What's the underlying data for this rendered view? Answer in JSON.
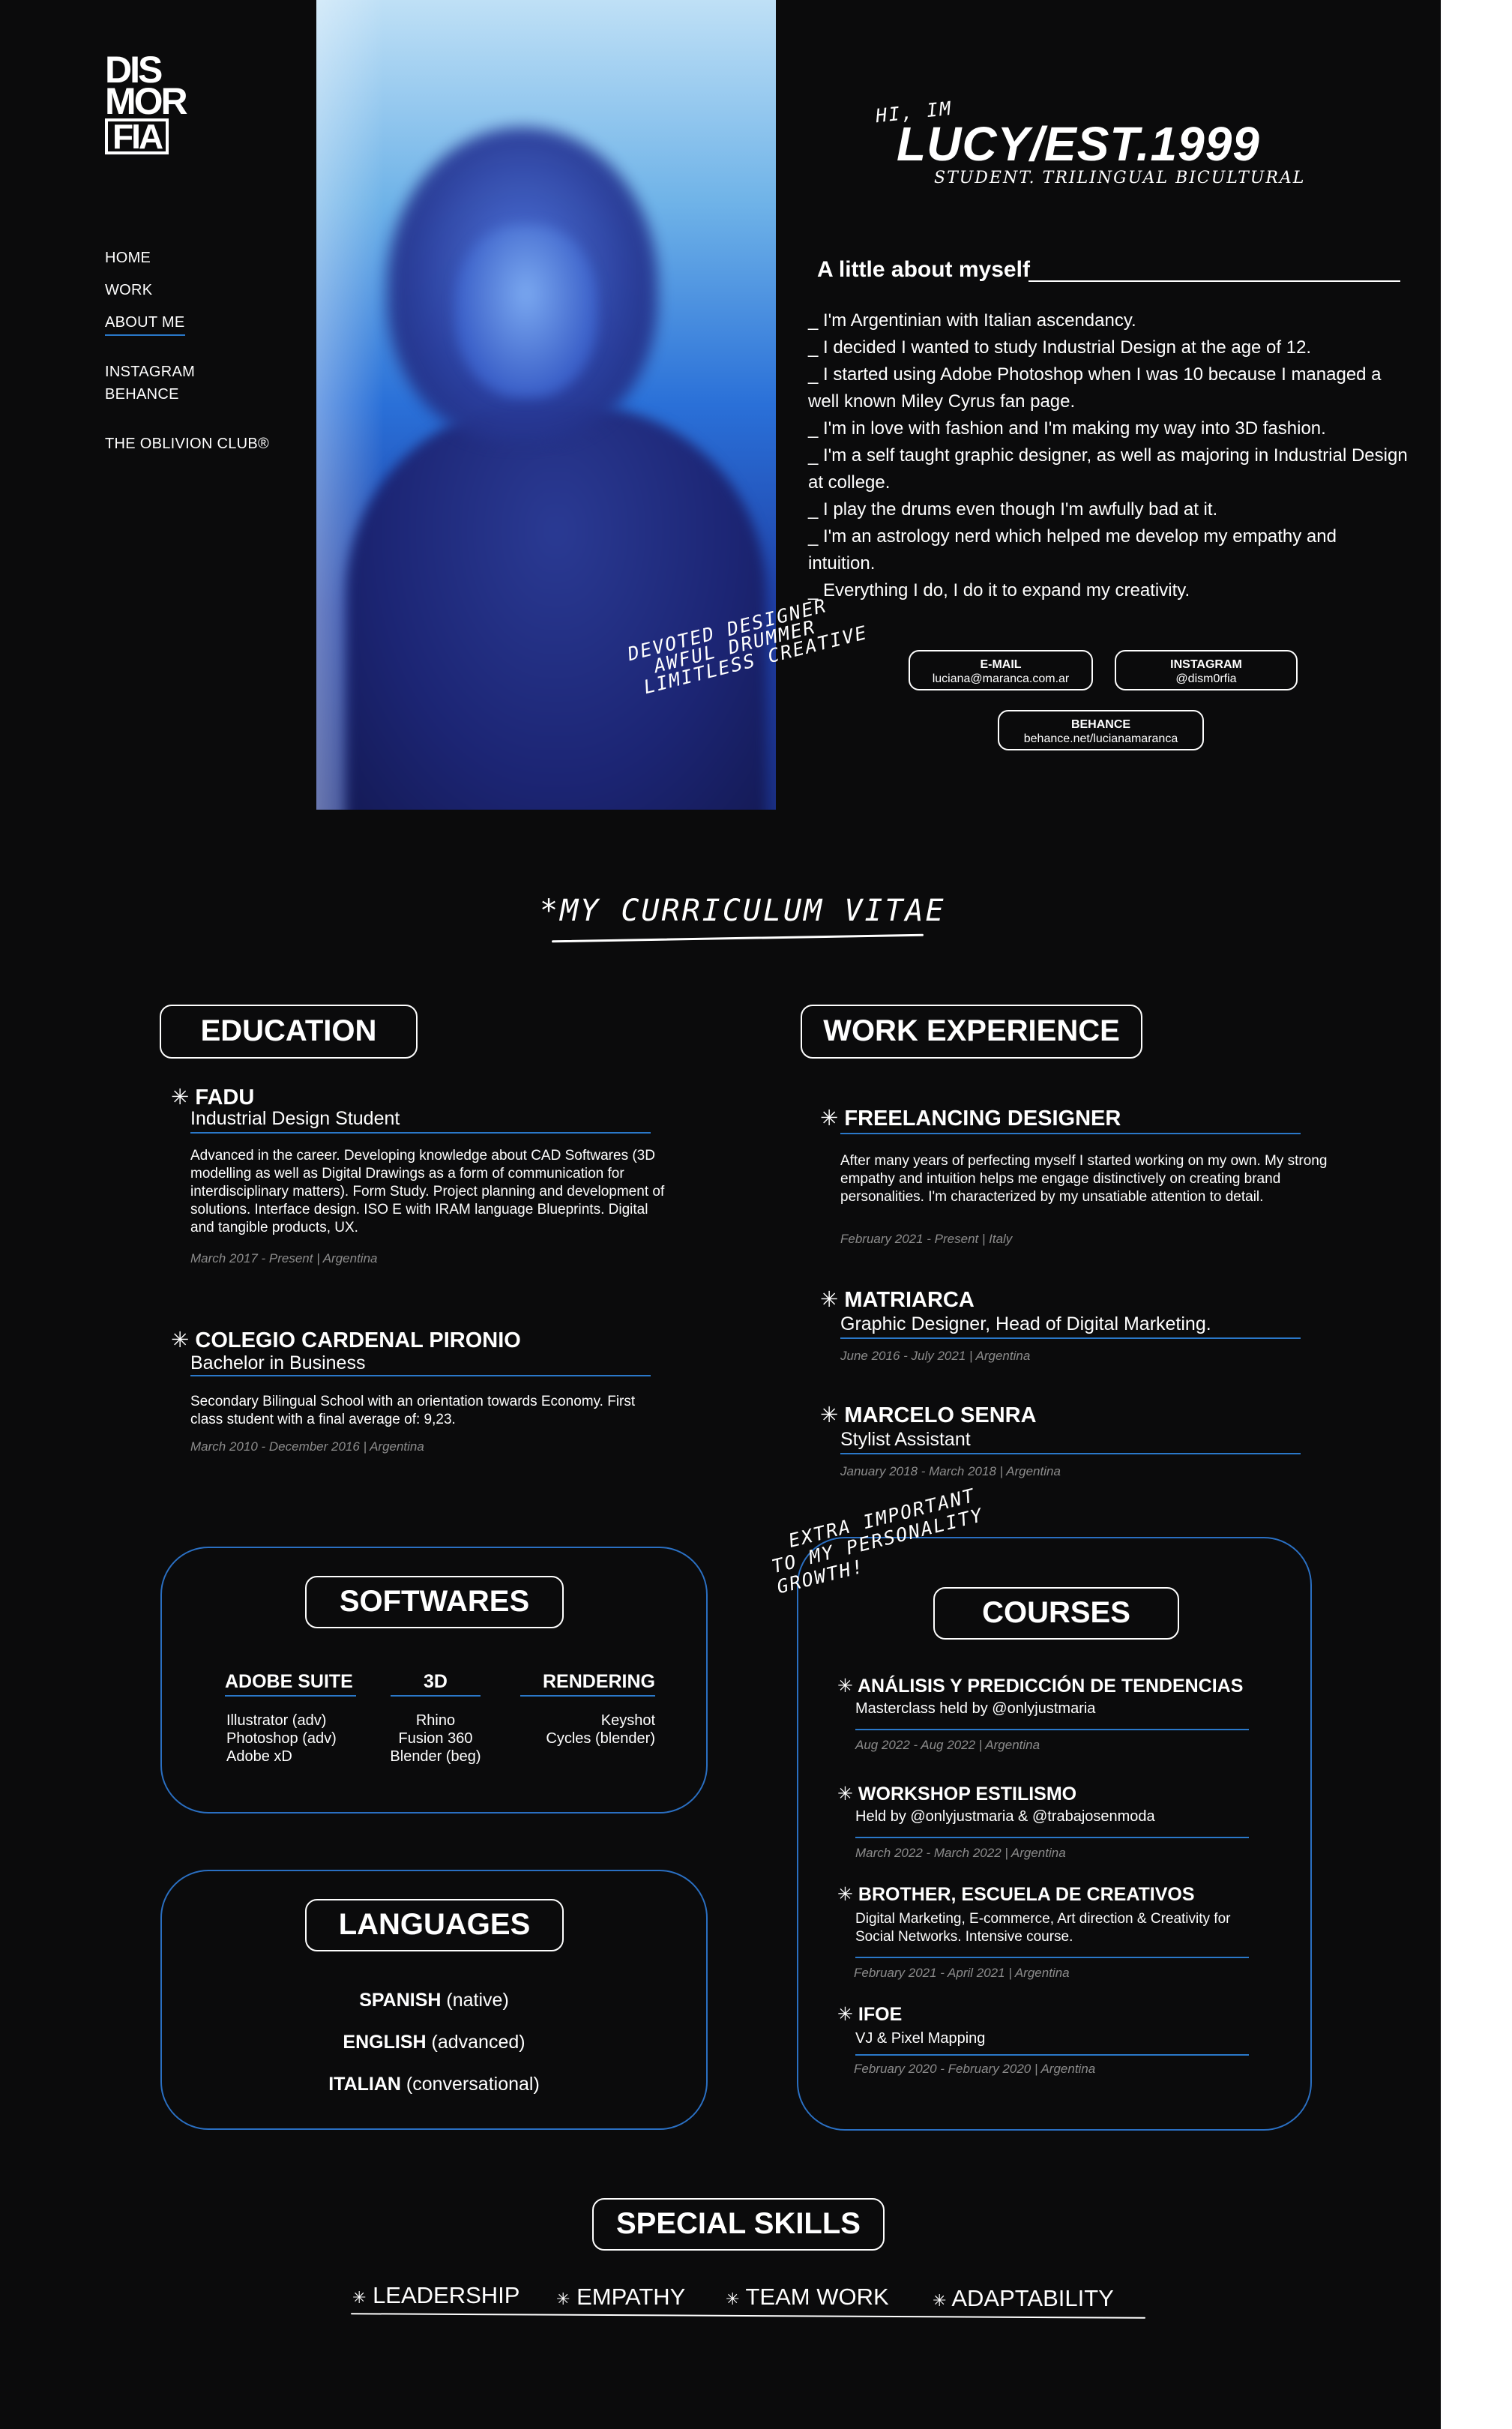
{
  "logo": {
    "line1": "DIS",
    "line2": "MOR",
    "line3": "FIA"
  },
  "nav": {
    "home": "HOME",
    "work": "WORK",
    "about": "ABOUT ME",
    "instagram": "INSTAGRAM",
    "behance": "BEHANCE",
    "club": "THE OBLIVION CLUB®"
  },
  "hero": {
    "hi": "HI, IM",
    "title": "LUCY/EST.1999",
    "tagline": "STUDENT. TRILINGUAL BICULTURAL"
  },
  "about": {
    "title": "A little about myself",
    "items": [
      "_ I'm Argentinian with Italian ascendancy.",
      "_ I decided I wanted to study Industrial Design at the age of 12.",
      "_ I started using Adobe Photoshop when I was 10 because I managed a well known Miley Cyrus fan page.",
      "_ I'm in love with fashion and I'm making my way into 3D fashion.",
      "_ I'm a self taught graphic designer, as well as majoring in Industrial Design at college.",
      "_ I play the drums even though I'm awfully bad at it.",
      "_ I'm an astrology nerd which helped me develop my empathy and intuition.",
      "_ Everything I do, I do it to expand my creativity."
    ]
  },
  "devoted": {
    "line1": "DEVOTED DESIGNER",
    "line2": "AWFUL DRUMMER",
    "line3": "LIMITLESS CREATIVE"
  },
  "contacts": {
    "email_label": "E-MAIL",
    "email_value": "luciana@maranca.com.ar",
    "instagram_label": "INSTAGRAM",
    "instagram_value": "@dism0rfia",
    "behance_label": "BEHANCE",
    "behance_value": "behance.net/lucianamaranca"
  },
  "cv_title": "*MY CURRICULUM VITAE",
  "education": {
    "heading": "EDUCATION",
    "items": [
      {
        "title": "FADU",
        "subtitle": "Industrial Design Student",
        "desc": "Advanced in the career. Developing knowledge about CAD Softwares (3D modelling as well as Digital Drawings as a form of communication for interdisciplinary matters). Form Study. Project planning and development of solutions. Interface design. ISO E with IRAM language Blueprints. Digital and tangible products, UX.",
        "date": "March 2017 - Present | Argentina"
      },
      {
        "title": "COLEGIO CARDENAL PIRONIO",
        "subtitle": "Bachelor in Business",
        "desc": "Secondary Bilingual School with an orientation towards Economy. First class student with a final average of: 9,23.",
        "date": "March 2010 - December 2016 | Argentina"
      }
    ]
  },
  "work": {
    "heading": "WORK EXPERIENCE",
    "items": [
      {
        "title": "FREELANCING DESIGNER",
        "desc": "After many years of perfecting myself I started working on my own. My strong empathy and intuition helps me engage distinctively on creating brand personalities. I'm characterized by my unsatiable attention to detail.",
        "date": "February 2021 - Present | Italy"
      },
      {
        "title": "MATRIARCA",
        "subtitle": "Graphic Designer, Head of Digital Marketing.",
        "date": "June 2016 - July 2021 | Argentina"
      },
      {
        "title": "MARCELO SENRA",
        "subtitle": "Stylist Assistant",
        "date": "January 2018 - March 2018 | Argentina"
      }
    ]
  },
  "softwares": {
    "heading": "SOFTWARES",
    "adobe": {
      "title": "ADOBE SUITE",
      "items": [
        "Illustrator (adv)",
        "Photoshop (adv)",
        "Adobe xD"
      ]
    },
    "threed": {
      "title": "3D",
      "items": [
        "Rhino",
        "Fusion 360",
        "Blender (beg)"
      ]
    },
    "rendering": {
      "title": "RENDERING",
      "items": [
        "Keyshot",
        "Cycles (blender)"
      ]
    }
  },
  "languages": {
    "heading": "LANGUAGES",
    "items": [
      {
        "name": "SPANISH",
        "level": "(native)"
      },
      {
        "name": "ENGLISH",
        "level": "(advanced)"
      },
      {
        "name": "ITALIAN",
        "level": "(conversational)"
      }
    ]
  },
  "extra_note": {
    "line1": "EXTRA IMPORTANT",
    "line2": "TO MY PERSONALITY",
    "line3": "GROWTH!"
  },
  "courses": {
    "heading": "COURSES",
    "items": [
      {
        "title": "ANÁLISIS Y PREDICCIÓN DE TENDENCIAS",
        "desc": "Masterclass held by @onlyjustmaria",
        "date": "Aug 2022 - Aug 2022 | Argentina"
      },
      {
        "title": "WORKSHOP ESTILISMO",
        "desc": "Held by @onlyjustmaria & @trabajosenmoda",
        "date": "March 2022 - March 2022 | Argentina"
      },
      {
        "title": "BROTHER, ESCUELA DE CREATIVOS",
        "desc": "Digital Marketing, E-commerce, Art direction & Creativity for Social Networks. Intensive course.",
        "date": "February 2021 - April 2021 | Argentina"
      },
      {
        "title": "IFOE",
        "desc": "VJ & Pixel Mapping",
        "date": "February 2020 - February 2020 | Argentina"
      }
    ]
  },
  "special": {
    "heading": "SPECIAL SKILLS",
    "items": [
      "LEADERSHIP",
      "EMPATHY",
      "TEAM WORK",
      "ADAPTABILITY"
    ]
  },
  "star_glyph": "✳",
  "colors": {
    "background": "#0b0b0c",
    "accent": "#2a78c9",
    "text": "#ffffff",
    "muted": "#8c8c8c"
  }
}
